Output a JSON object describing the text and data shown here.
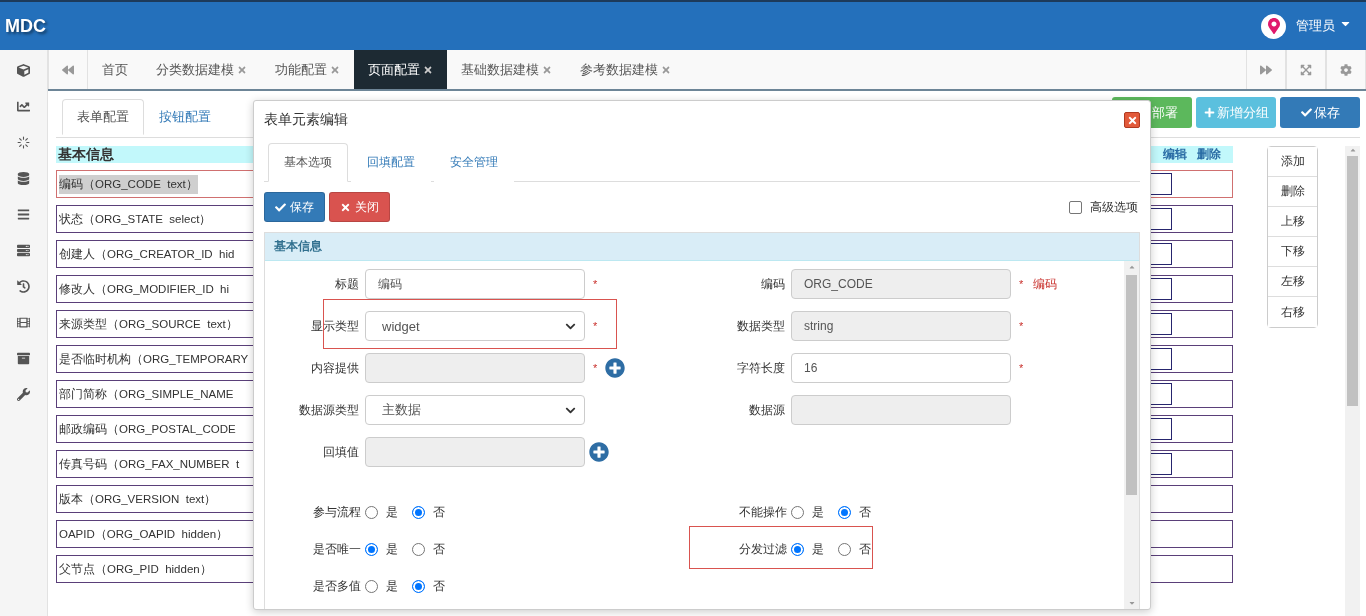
{
  "header": {
    "logo": "MDC",
    "user": "管理员"
  },
  "tabs": [
    {
      "label": "首页",
      "closable": false,
      "selected": false
    },
    {
      "label": "分类数据建模",
      "closable": true,
      "selected": false
    },
    {
      "label": "功能配置",
      "closable": true,
      "selected": false
    },
    {
      "label": "页面配置",
      "closable": true,
      "selected": true
    },
    {
      "label": "基础数据建模",
      "closable": true,
      "selected": false
    },
    {
      "label": "参考数据建模",
      "closable": true,
      "selected": false
    }
  ],
  "subtabs": [
    {
      "label": "表单配置",
      "selected": true
    },
    {
      "label": "按钮配置",
      "selected": false
    }
  ],
  "actions": [
    {
      "label": "部署",
      "kind": "deploy"
    },
    {
      "label": "新增分组",
      "kind": "add"
    },
    {
      "label": "保存",
      "kind": "save"
    }
  ],
  "form": {
    "title": "基本信息",
    "header_actions": [
      "编辑",
      "删除"
    ],
    "rows": [
      {
        "label": "编码（ORG_CODE  text）",
        "selected": true,
        "inner_box": true
      },
      {
        "label": "状态（ORG_STATE  select）",
        "selected": false,
        "inner_box": true
      },
      {
        "label": "创建人（ORG_CREATOR_ID  hid",
        "selected": false,
        "inner_box": true
      },
      {
        "label": "修改人（ORG_MODIFIER_ID  hi",
        "selected": false,
        "inner_box": true
      },
      {
        "label": "来源类型（ORG_SOURCE  text）",
        "selected": false,
        "inner_box": true
      },
      {
        "label": "是否临时机构（ORG_TEMPORARY",
        "selected": false,
        "inner_box": true
      },
      {
        "label": "部门简称（ORG_SIMPLE_NAME",
        "selected": false,
        "inner_box": true
      },
      {
        "label": "邮政编码（ORG_POSTAL_CODE",
        "selected": false,
        "inner_box": true
      },
      {
        "label": "传真号码（ORG_FAX_NUMBER  t",
        "selected": false,
        "inner_box": true
      },
      {
        "label": "版本（ORG_VERSION  text）",
        "selected": false,
        "inner_box": false
      },
      {
        "label": "OAPID（ORG_OAPID  hidden）",
        "selected": false,
        "inner_box": false
      },
      {
        "label": "父节点（ORG_PID  hidden）",
        "selected": false,
        "inner_box": false
      }
    ]
  },
  "side_buttons": [
    "添加",
    "删除",
    "上移",
    "下移",
    "左移",
    "右移"
  ],
  "dialog": {
    "title": "表单元素编辑",
    "tabs": [
      {
        "label": "基本选项",
        "selected": true
      },
      {
        "label": "回填配置",
        "selected": false
      },
      {
        "label": "安全管理",
        "selected": false
      }
    ],
    "buttons": [
      {
        "label": "保存",
        "kind": "save"
      },
      {
        "label": "关闭",
        "kind": "close"
      }
    ],
    "advanced": {
      "label": "高级选项",
      "checked": false
    },
    "section_title": "基本信息",
    "left_fields": [
      {
        "label": "标题",
        "kind": "input",
        "value": "编码",
        "disabled": false,
        "marker": "*",
        "add_button": false,
        "highlighted": false
      },
      {
        "label": "显示类型",
        "kind": "select",
        "value": "widget",
        "disabled": false,
        "marker": "*",
        "add_button": false,
        "highlighted": true
      },
      {
        "label": "内容提供",
        "kind": "input",
        "disabled": true,
        "marker": "*",
        "add_button": true,
        "highlighted": false
      },
      {
        "label": "数据源类型",
        "kind": "select",
        "value": "主数据",
        "disabled": false,
        "add_button": false,
        "highlighted": false
      },
      {
        "label": "回填值",
        "kind": "input",
        "disabled": true,
        "add_button": true,
        "highlighted": false
      }
    ],
    "right_fields": [
      {
        "label": "编码",
        "kind": "input",
        "value": "ORG_CODE",
        "disabled": true,
        "marker": "*",
        "note": "编码",
        "add_button": false,
        "highlighted": false
      },
      {
        "label": "数据类型",
        "kind": "input",
        "value": "string",
        "disabled": true,
        "marker": "*",
        "add_button": false,
        "highlighted": false
      },
      {
        "label": "字符长度",
        "kind": "input",
        "value": "16",
        "disabled": false,
        "marker": "*",
        "add_button": false,
        "highlighted": false
      },
      {
        "label": "数据源",
        "kind": "input",
        "disabled": true,
        "add_button": false,
        "highlighted": false
      }
    ],
    "left_radios": [
      {
        "label": "参与流程",
        "highlighted": false,
        "options": [
          {
            "label": "是",
            "selected": false
          },
          {
            "label": "否",
            "selected": true
          }
        ]
      },
      {
        "label": "是否唯一",
        "highlighted": false,
        "options": [
          {
            "label": "是",
            "selected": true
          },
          {
            "label": "否",
            "selected": false
          }
        ]
      },
      {
        "label": "是否多值",
        "highlighted": false,
        "options": [
          {
            "label": "是",
            "selected": false
          },
          {
            "label": "否",
            "selected": true
          }
        ]
      }
    ],
    "right_radios": [
      {
        "label": "不能操作",
        "highlighted": false,
        "options": [
          {
            "label": "是",
            "selected": false
          },
          {
            "label": "否",
            "selected": true
          }
        ]
      },
      {
        "label": "分发过滤",
        "highlighted": true,
        "options": [
          {
            "label": "是",
            "selected": true
          },
          {
            "label": "否",
            "selected": false
          }
        ]
      }
    ]
  }
}
